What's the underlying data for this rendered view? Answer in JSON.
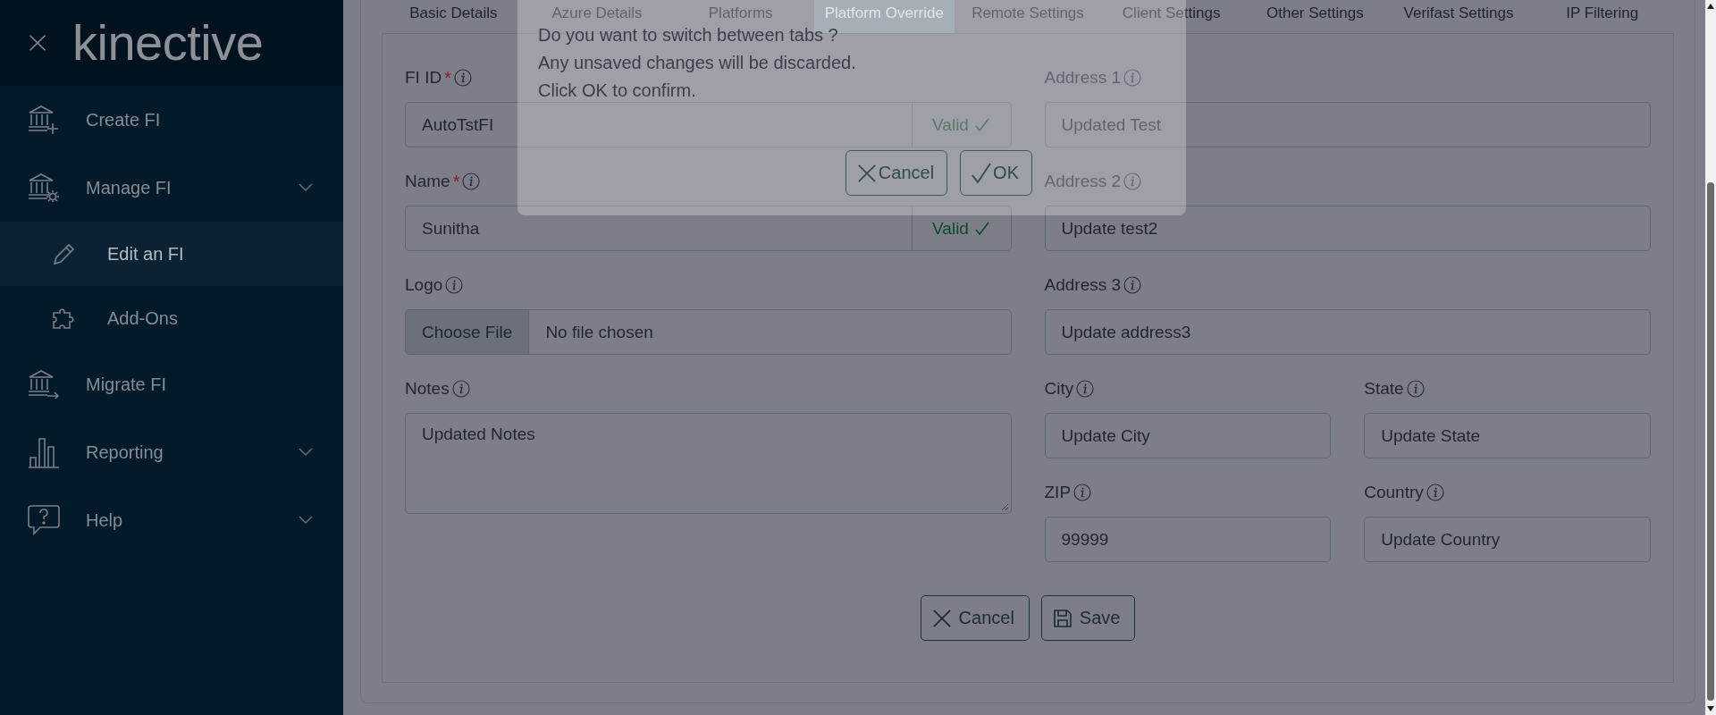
{
  "sidebar": {
    "logo": "kinective",
    "items": [
      {
        "label": "Create FI",
        "kind": "bank-plus",
        "selected": false,
        "has_submenu": false
      },
      {
        "label": "Manage FI",
        "kind": "bank-gear",
        "selected": false,
        "has_submenu": true,
        "children": [
          {
            "label": "Edit an FI",
            "kind": "pencil",
            "selected": true
          },
          {
            "label": "Add-Ons",
            "kind": "puzzle",
            "selected": false
          }
        ]
      },
      {
        "label": "Migrate FI",
        "kind": "bank-arrow",
        "selected": false,
        "has_submenu": false
      },
      {
        "label": "Reporting",
        "kind": "bar-chart",
        "selected": false,
        "has_submenu": true
      },
      {
        "label": "Help",
        "kind": "help",
        "selected": false,
        "has_submenu": true
      }
    ]
  },
  "tabs": [
    {
      "label": "Basic Details",
      "selected": false
    },
    {
      "label": "Azure Details",
      "selected": false
    },
    {
      "label": "Platforms",
      "selected": false
    },
    {
      "label": "Platform Override",
      "selected": true
    },
    {
      "label": "Remote Settings",
      "selected": false
    },
    {
      "label": "Client Settings",
      "selected": false
    },
    {
      "label": "Other Settings",
      "selected": false
    },
    {
      "label": "Verifast Settings",
      "selected": false
    },
    {
      "label": "IP Filtering",
      "selected": false
    }
  ],
  "form": {
    "left_column": [
      {
        "label": "FI ID",
        "required_mark": "*",
        "kind": "text",
        "value": "AutoTstFI",
        "validation": "Valid"
      },
      {
        "label": "Name",
        "required_mark": "*",
        "kind": "text",
        "value": "Sunitha",
        "validation": "Valid"
      },
      {
        "label": "Logo",
        "kind": "file",
        "button": "Choose File",
        "value": "No file chosen"
      },
      {
        "label": "Notes",
        "kind": "textarea",
        "value": "Updated Notes"
      }
    ],
    "right_column": [
      [
        {
          "label": "Address 1",
          "kind": "text",
          "value": "Updated Test"
        }
      ],
      [
        {
          "label": "Address 2",
          "kind": "text",
          "value": "Update test2"
        }
      ],
      [
        {
          "label": "Address 3",
          "kind": "text",
          "value": "Update address3"
        }
      ],
      [
        {
          "label": "City",
          "kind": "text",
          "value": "Update City"
        },
        {
          "label": "State",
          "kind": "text",
          "value": "Update State"
        }
      ],
      [
        {
          "label": "ZIP",
          "kind": "text",
          "value": "99999"
        },
        {
          "label": "Country",
          "kind": "text",
          "value": "Update Country"
        }
      ]
    ],
    "buttons": [
      {
        "label": "Cancel",
        "kind": "cancel"
      },
      {
        "label": "Save",
        "kind": "save"
      }
    ]
  },
  "dialog": {
    "lines": [
      "Do you want to switch between tabs ?",
      "Any unsaved changes will be discarded.",
      "Click OK to confirm."
    ],
    "buttons": [
      {
        "label": "Cancel",
        "kind": "cancel"
      },
      {
        "label": "OK",
        "kind": "ok"
      }
    ]
  }
}
